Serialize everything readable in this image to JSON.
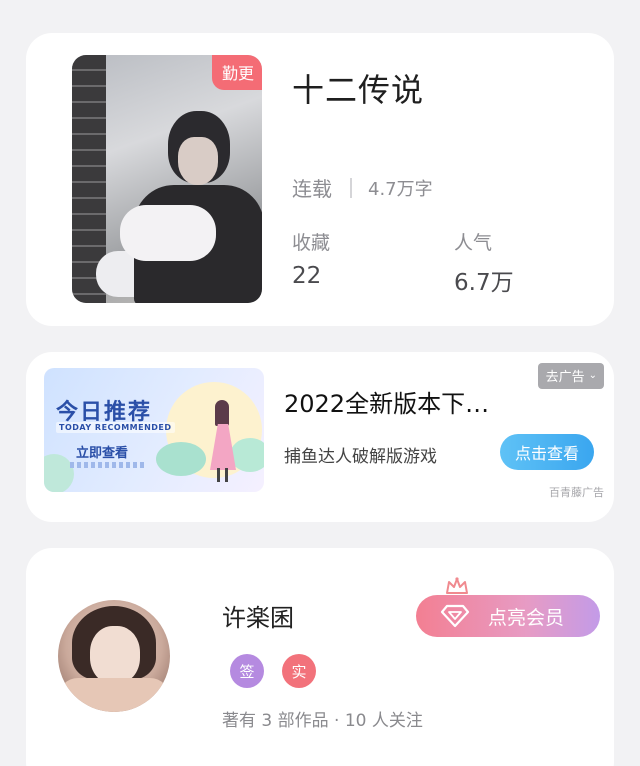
{
  "book": {
    "cover_tag": "勤更",
    "title": "十二传说",
    "status": "连载",
    "word_count": "4.7万字",
    "stats": [
      {
        "label": "收藏",
        "value": "22"
      },
      {
        "label": "人气",
        "value": "6.7万"
      }
    ]
  },
  "ad": {
    "banner": {
      "heading": "今日推荐",
      "subheading": "TODAY RECOMMENDED",
      "cta": "立即查看"
    },
    "title": "2022全新版本下…",
    "description": "捕鱼达人破解版游戏",
    "close_label": "去广告",
    "button_label": "点击查看",
    "source": "百青藤广告"
  },
  "author": {
    "name": "许楽囷",
    "badges": [
      "签",
      "实"
    ],
    "stats_text": "著有 3 部作品 · 10 人关注",
    "vip_button_label": "点亮会员"
  },
  "colors": {
    "page_bg": "#f2f2f4",
    "tag_red": "#f46c75",
    "ad_button_blue": "#3aa6ef",
    "badge_purple": "#b58ae0",
    "badge_red": "#f2727b",
    "vip_gradient_start": "#f37f92",
    "vip_gradient_end": "#c39be8"
  },
  "icons": {
    "close_chevron": "chevron-down-icon",
    "vip_gem": "diamond-icon",
    "vip_crown": "crown-icon"
  }
}
